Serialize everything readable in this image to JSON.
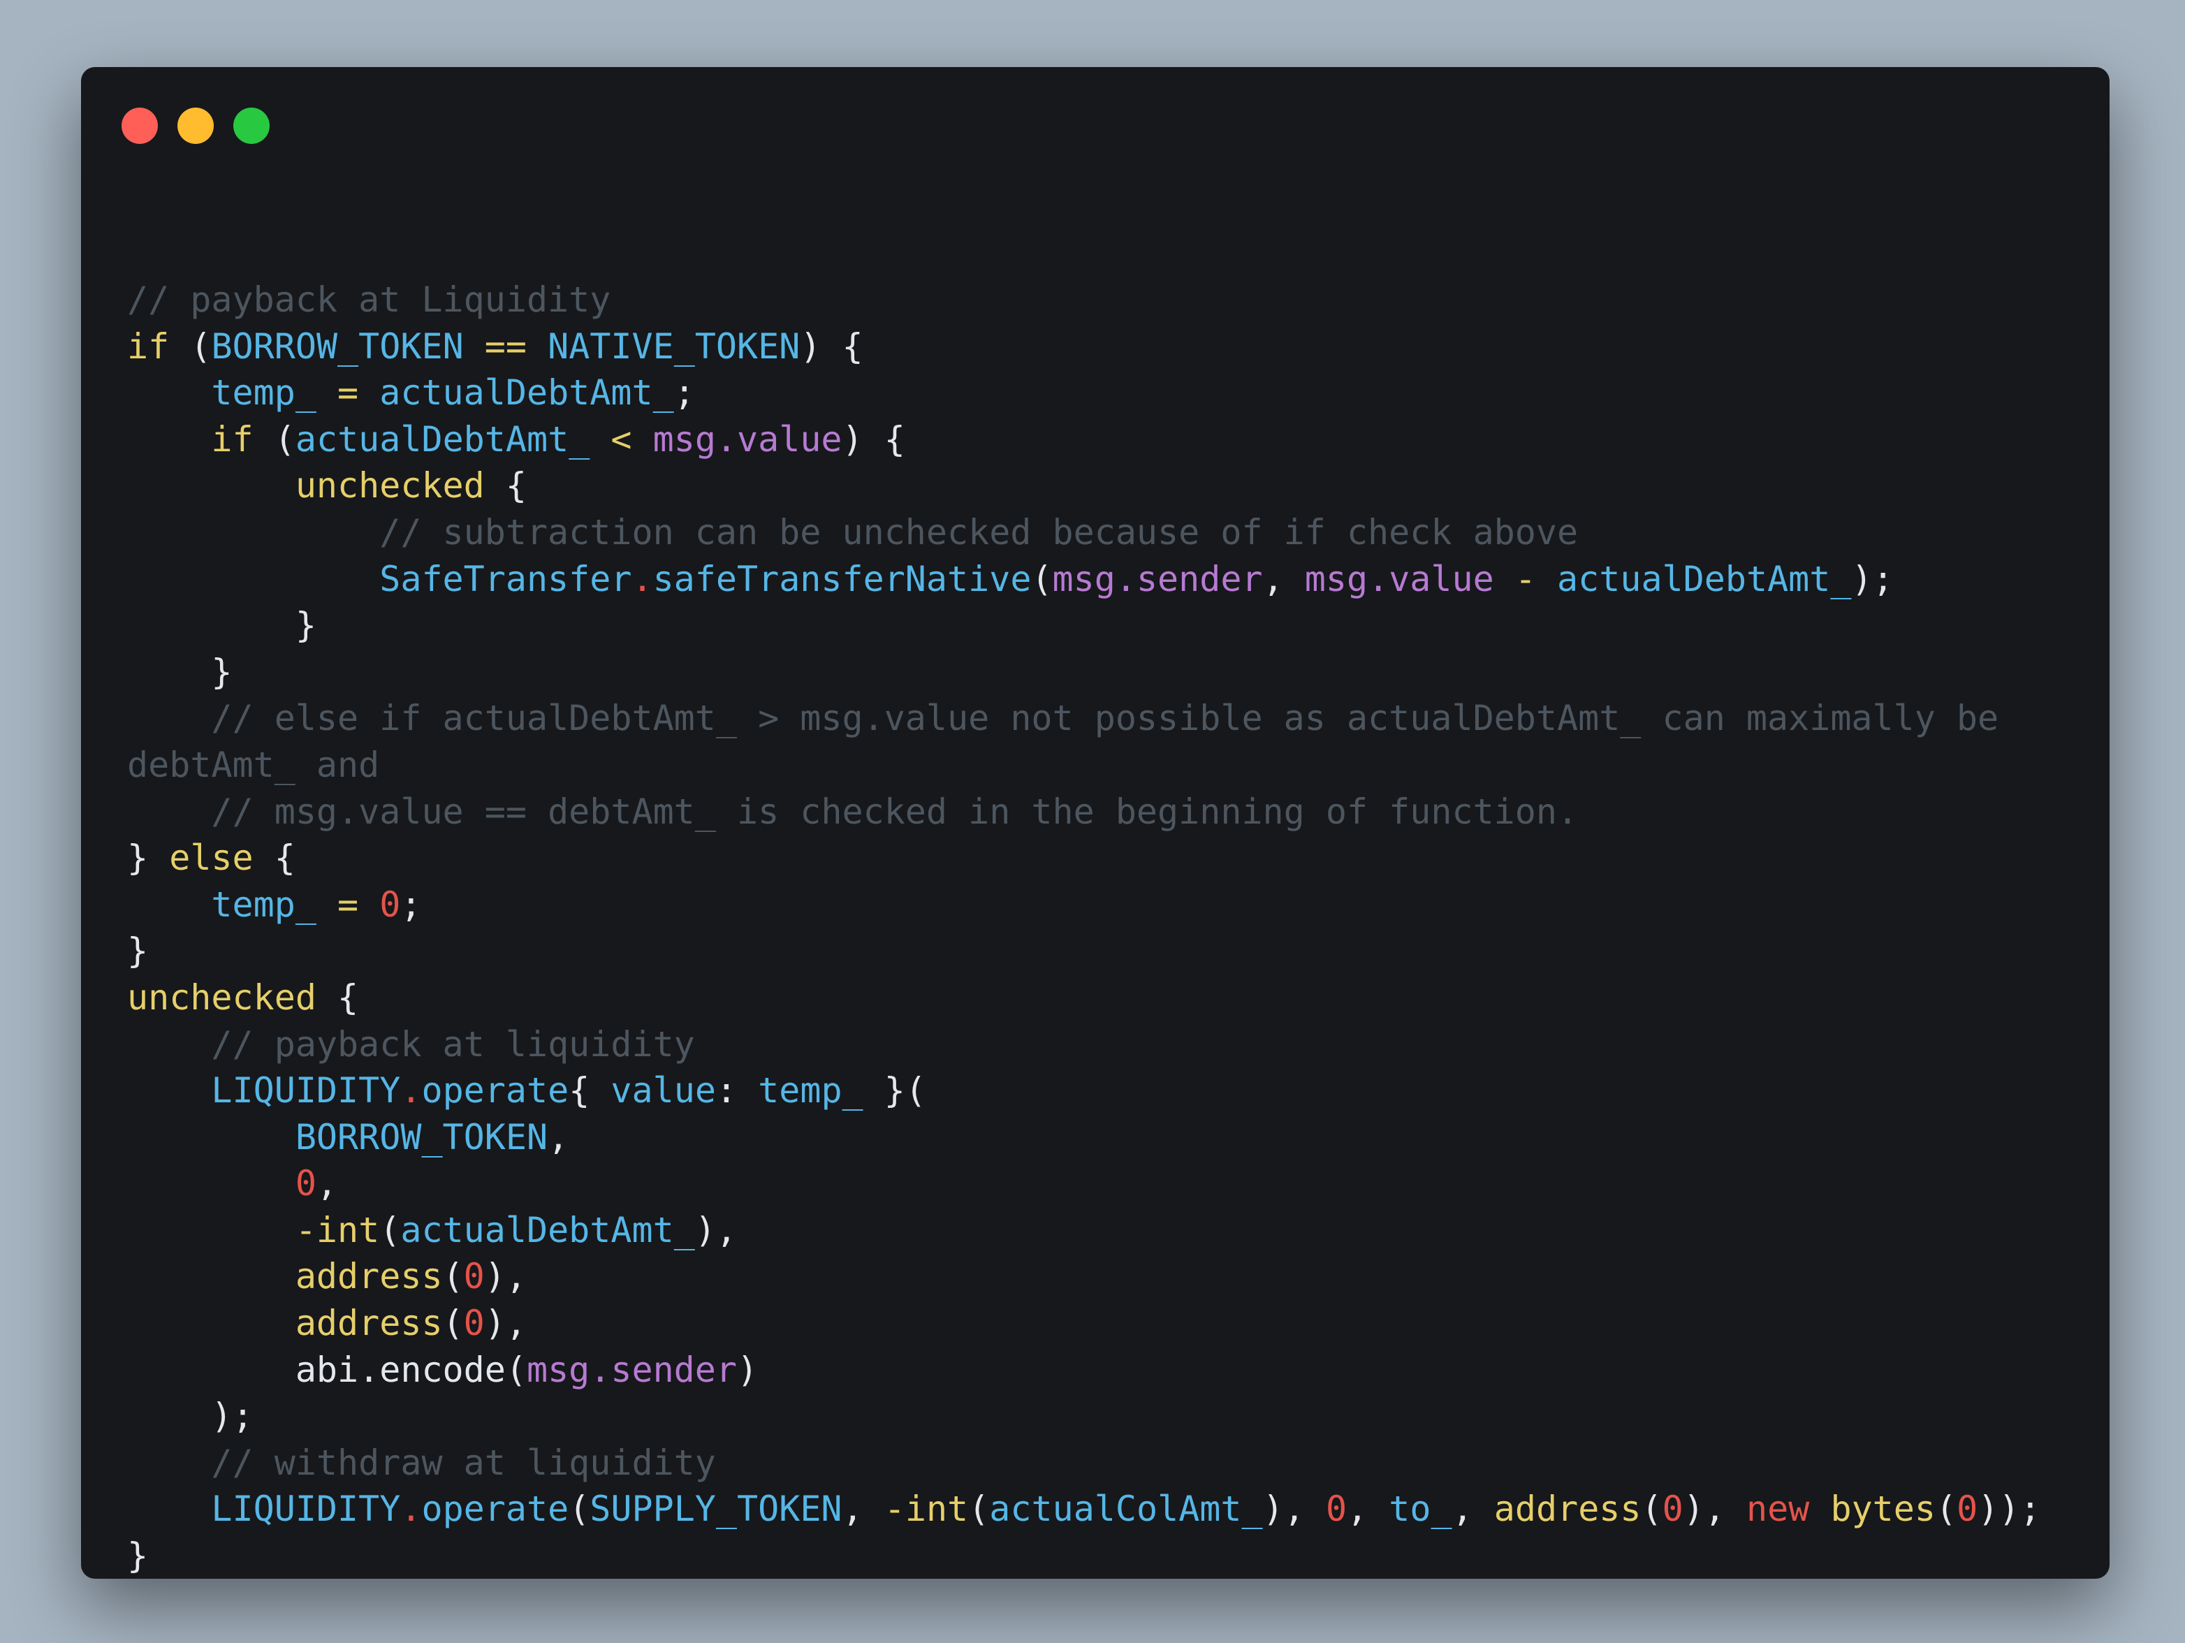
{
  "window": {
    "controls": [
      "close",
      "minimize",
      "maximize"
    ],
    "colors": {
      "close": "#ff5f57",
      "minimize": "#febc2e",
      "maximize": "#28c840"
    }
  },
  "code": {
    "language": "solidity",
    "lines": [
      [
        {
          "t": "// payback at Liquidity",
          "c": "cm"
        }
      ],
      [
        {
          "t": "if",
          "c": "kw"
        },
        {
          "t": " (",
          "c": "pl"
        },
        {
          "t": "BORROW_TOKEN",
          "c": "id"
        },
        {
          "t": " == ",
          "c": "kw"
        },
        {
          "t": "NATIVE_TOKEN",
          "c": "id"
        },
        {
          "t": ") {",
          "c": "pl"
        }
      ],
      [
        {
          "t": "    "
        },
        {
          "t": "temp_",
          "c": "id"
        },
        {
          "t": " = ",
          "c": "kw"
        },
        {
          "t": "actualDebtAmt_",
          "c": "id"
        },
        {
          "t": ";",
          "c": "pl"
        }
      ],
      [
        {
          "t": "    "
        },
        {
          "t": "if",
          "c": "kw"
        },
        {
          "t": " (",
          "c": "pl"
        },
        {
          "t": "actualDebtAmt_",
          "c": "id"
        },
        {
          "t": " < ",
          "c": "kw"
        },
        {
          "t": "msg.value",
          "c": "pr"
        },
        {
          "t": ") {",
          "c": "pl"
        }
      ],
      [
        {
          "t": "        "
        },
        {
          "t": "unchecked",
          "c": "kw"
        },
        {
          "t": " {",
          "c": "pl"
        }
      ],
      [
        {
          "t": "            "
        },
        {
          "t": "// subtraction can be unchecked because of if check above",
          "c": "cm"
        }
      ],
      [
        {
          "t": "            "
        },
        {
          "t": "SafeTransfer",
          "c": "id"
        },
        {
          "t": ".",
          "c": "red"
        },
        {
          "t": "safeTransferNative",
          "c": "id"
        },
        {
          "t": "(",
          "c": "pl"
        },
        {
          "t": "msg.sender",
          "c": "pr"
        },
        {
          "t": ", ",
          "c": "pl"
        },
        {
          "t": "msg.value",
          "c": "pr"
        },
        {
          "t": " - ",
          "c": "kw"
        },
        {
          "t": "actualDebtAmt_",
          "c": "id"
        },
        {
          "t": ");",
          "c": "pl"
        }
      ],
      [
        {
          "t": "        "
        },
        {
          "t": "}",
          "c": "pl"
        }
      ],
      [
        {
          "t": "    "
        },
        {
          "t": "}",
          "c": "pl"
        }
      ],
      [
        {
          "t": "    "
        },
        {
          "t": "// else if actualDebtAmt_ > msg.value not possible as actualDebtAmt_ can maximally be",
          "c": "cm"
        }
      ],
      [
        {
          "t": "debtAmt_ and",
          "c": "cm"
        }
      ],
      [
        {
          "t": "    "
        },
        {
          "t": "// msg.value == debtAmt_ is checked in the beginning of function.",
          "c": "cm"
        }
      ],
      [
        {
          "t": "} ",
          "c": "pl"
        },
        {
          "t": "else",
          "c": "kw"
        },
        {
          "t": " {",
          "c": "pl"
        }
      ],
      [
        {
          "t": "    "
        },
        {
          "t": "temp_",
          "c": "id"
        },
        {
          "t": " = ",
          "c": "kw"
        },
        {
          "t": "0",
          "c": "num"
        },
        {
          "t": ";",
          "c": "pl"
        }
      ],
      [
        {
          "t": "}",
          "c": "pl"
        }
      ],
      [
        {
          "t": "unchecked",
          "c": "kw"
        },
        {
          "t": " {",
          "c": "pl"
        }
      ],
      [
        {
          "t": "    "
        },
        {
          "t": "// payback at liquidity",
          "c": "cm"
        }
      ],
      [
        {
          "t": "    "
        },
        {
          "t": "LIQUIDITY",
          "c": "id"
        },
        {
          "t": ".",
          "c": "red"
        },
        {
          "t": "operate",
          "c": "id"
        },
        {
          "t": "{ ",
          "c": "pl"
        },
        {
          "t": "value",
          "c": "id"
        },
        {
          "t": ": ",
          "c": "pl"
        },
        {
          "t": "temp_",
          "c": "id"
        },
        {
          "t": " }(",
          "c": "pl"
        }
      ],
      [
        {
          "t": "        "
        },
        {
          "t": "BORROW_TOKEN",
          "c": "id"
        },
        {
          "t": ",",
          "c": "pl"
        }
      ],
      [
        {
          "t": "        "
        },
        {
          "t": "0",
          "c": "num"
        },
        {
          "t": ",",
          "c": "pl"
        }
      ],
      [
        {
          "t": "        "
        },
        {
          "t": "-int",
          "c": "kw"
        },
        {
          "t": "(",
          "c": "pl"
        },
        {
          "t": "actualDebtAmt_",
          "c": "id"
        },
        {
          "t": "),",
          "c": "pl"
        }
      ],
      [
        {
          "t": "        "
        },
        {
          "t": "address",
          "c": "kw"
        },
        {
          "t": "(",
          "c": "pl"
        },
        {
          "t": "0",
          "c": "num"
        },
        {
          "t": "),",
          "c": "pl"
        }
      ],
      [
        {
          "t": "        "
        },
        {
          "t": "address",
          "c": "kw"
        },
        {
          "t": "(",
          "c": "pl"
        },
        {
          "t": "0",
          "c": "num"
        },
        {
          "t": "),",
          "c": "pl"
        }
      ],
      [
        {
          "t": "        "
        },
        {
          "t": "abi.encode",
          "c": "pl"
        },
        {
          "t": "(",
          "c": "pl"
        },
        {
          "t": "msg.sender",
          "c": "pr"
        },
        {
          "t": ")",
          "c": "pl"
        }
      ],
      [
        {
          "t": "    "
        },
        {
          "t": ");",
          "c": "pl"
        }
      ],
      [
        {
          "t": "    "
        },
        {
          "t": "// withdraw at liquidity",
          "c": "cm"
        }
      ],
      [
        {
          "t": "    "
        },
        {
          "t": "LIQUIDITY",
          "c": "id"
        },
        {
          "t": ".",
          "c": "red"
        },
        {
          "t": "operate",
          "c": "id"
        },
        {
          "t": "(",
          "c": "pl"
        },
        {
          "t": "SUPPLY_TOKEN",
          "c": "id"
        },
        {
          "t": ", ",
          "c": "pl"
        },
        {
          "t": "-int",
          "c": "kw"
        },
        {
          "t": "(",
          "c": "pl"
        },
        {
          "t": "actualColAmt_",
          "c": "id"
        },
        {
          "t": "), ",
          "c": "pl"
        },
        {
          "t": "0",
          "c": "num"
        },
        {
          "t": ", ",
          "c": "pl"
        },
        {
          "t": "to_",
          "c": "id"
        },
        {
          "t": ", ",
          "c": "pl"
        },
        {
          "t": "address",
          "c": "kw"
        },
        {
          "t": "(",
          "c": "pl"
        },
        {
          "t": "0",
          "c": "num"
        },
        {
          "t": "), ",
          "c": "pl"
        },
        {
          "t": "new",
          "c": "red"
        },
        {
          "t": " ",
          "c": "pl"
        },
        {
          "t": "bytes",
          "c": "kw"
        },
        {
          "t": "(",
          "c": "pl"
        },
        {
          "t": "0",
          "c": "num"
        },
        {
          "t": "));",
          "c": "pl"
        }
      ],
      [
        {
          "t": "}",
          "c": "pl"
        }
      ]
    ]
  }
}
